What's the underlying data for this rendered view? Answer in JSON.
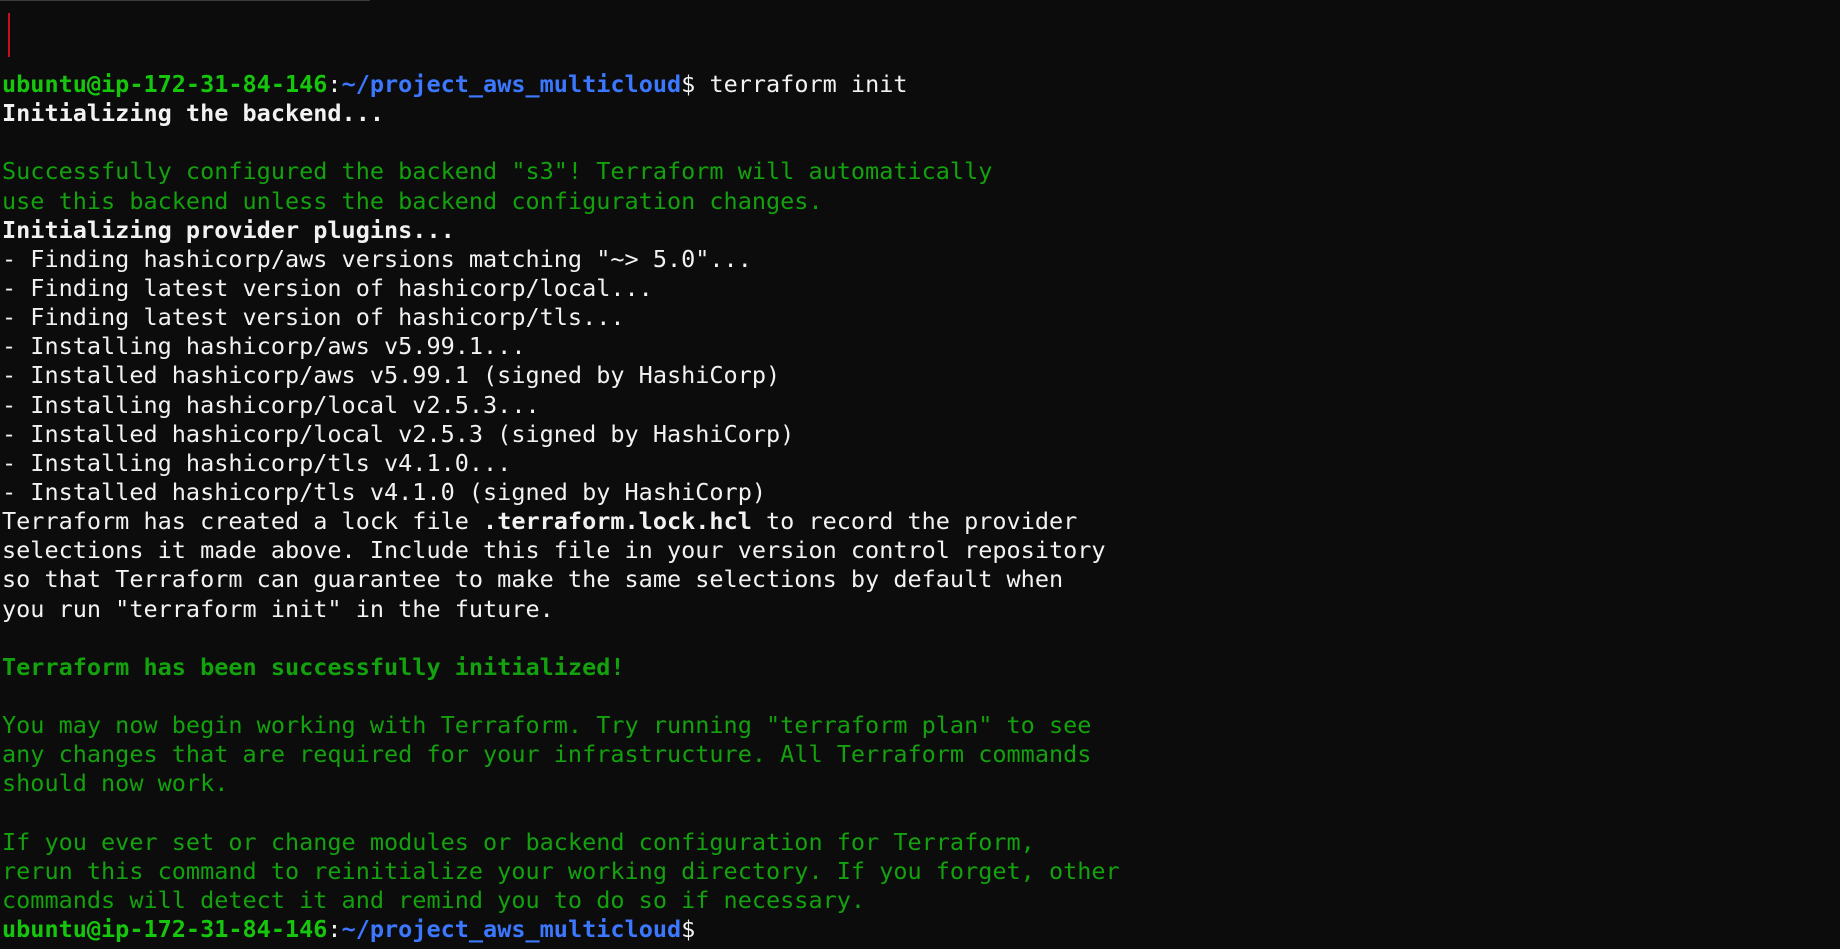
{
  "prompt": {
    "user_host": "ubuntu@ip-172-31-84-146",
    "sep": ":",
    "path": "~/project_aws_multicloud",
    "symbol": "$"
  },
  "command": " terraform init",
  "lines": {
    "l02": "Initializing the backend...",
    "l04": "Successfully configured the backend \"s3\"! Terraform will automatically",
    "l05": "use this backend unless the backend configuration changes.",
    "l06": "Initializing provider plugins...",
    "l07": "- Finding hashicorp/aws versions matching \"~> 5.0\"...",
    "l08": "- Finding latest version of hashicorp/local...",
    "l09": "- Finding latest version of hashicorp/tls...",
    "l10": "- Installing hashicorp/aws v5.99.1...",
    "l11": "- Installed hashicorp/aws v5.99.1 (signed by HashiCorp)",
    "l12": "- Installing hashicorp/local v2.5.3...",
    "l13": "- Installed hashicorp/local v2.5.3 (signed by HashiCorp)",
    "l14": "- Installing hashicorp/tls v4.1.0...",
    "l15": "- Installed hashicorp/tls v4.1.0 (signed by HashiCorp)",
    "l16a": "Terraform has created a lock file ",
    "l16b": ".terraform.lock.hcl",
    "l16c": " to record the provider",
    "l17": "selections it made above. Include this file in your version control repository",
    "l18": "so that Terraform can guarantee to make the same selections by default when",
    "l19": "you run \"terraform init\" in the future.",
    "l21": "Terraform has been successfully initialized!",
    "l23": "You may now begin working with Terraform. Try running \"terraform plan\" to see",
    "l24": "any changes that are required for your infrastructure. All Terraform commands",
    "l25": "should now work.",
    "l27": "If you ever set or change modules or backend configuration for Terraform,",
    "l28": "rerun this command to reinitialize your working directory. If you forget, other",
    "l29": "commands will detect it and remind you to do so if necessary."
  },
  "colors": {
    "background": "#0c0c0c",
    "foreground": "#cccccc",
    "bright_white": "#f2f2f2",
    "green": "#13a10e",
    "prompt_green": "#16c60c",
    "prompt_blue": "#3b78ff",
    "marker_red": "#c50f1f"
  }
}
